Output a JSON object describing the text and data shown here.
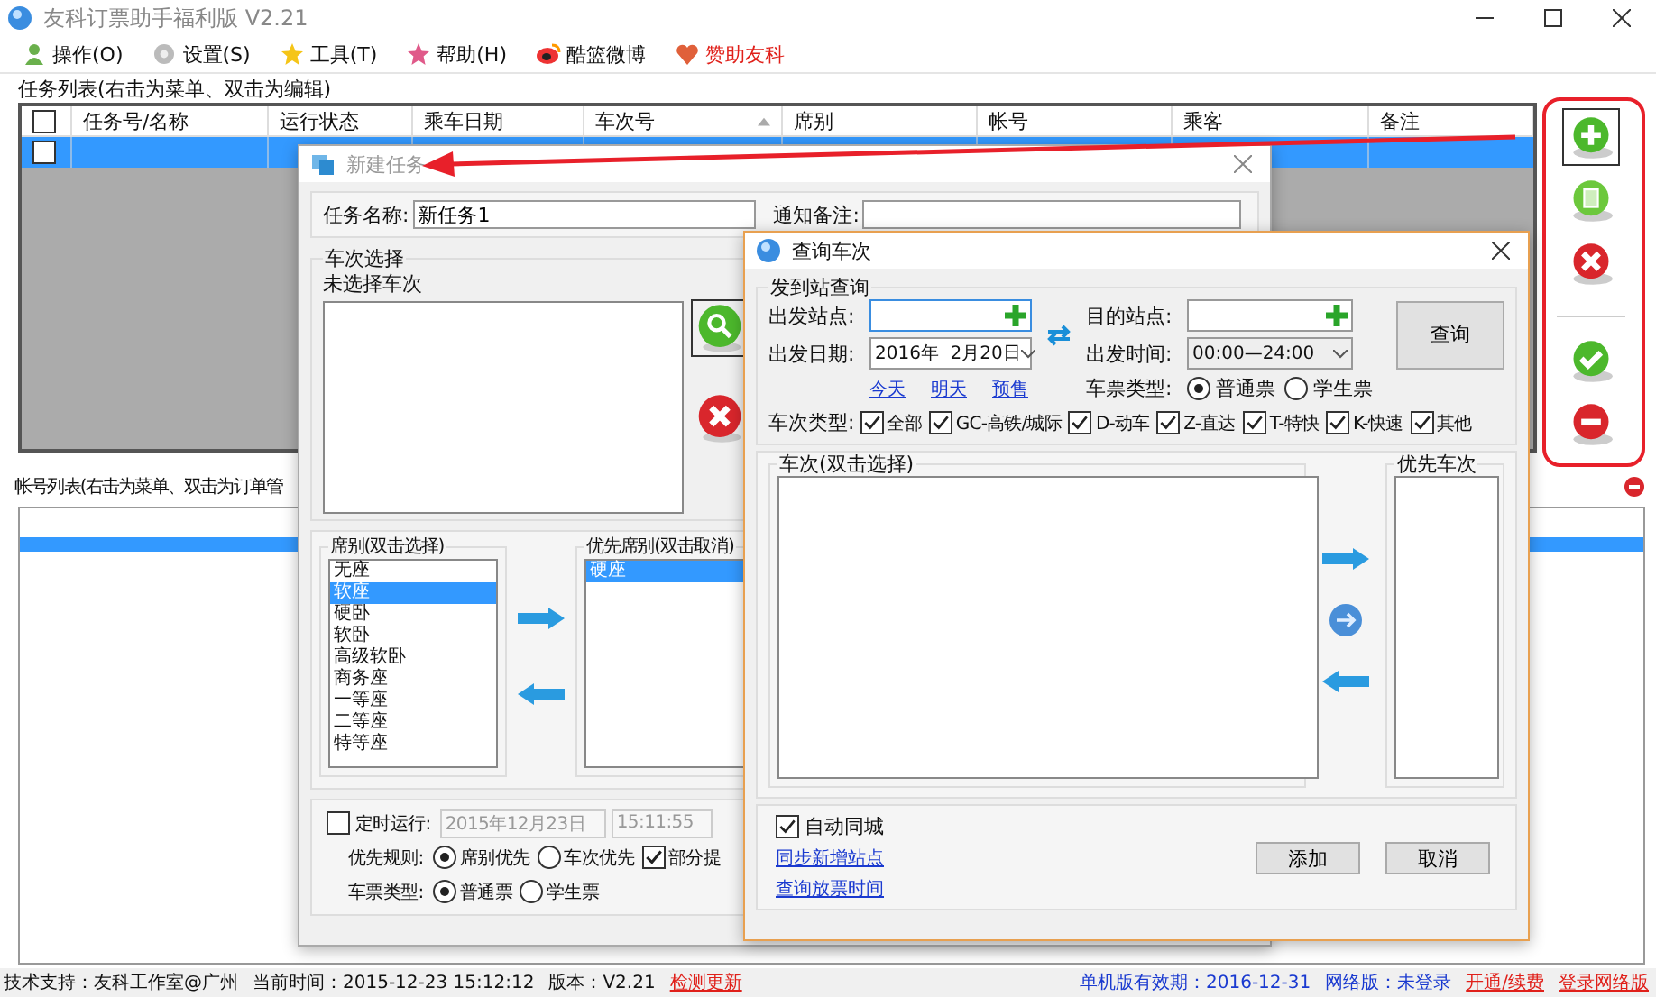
{
  "window": {
    "title": "友科订票助手福利版 V2.21"
  },
  "menu": [
    {
      "label": "操作(O)",
      "kind": "user",
      "emphasized": false
    },
    {
      "label": "设置(S)",
      "kind": "gear",
      "emphasized": false
    },
    {
      "label": "工具(T)",
      "kind": "star",
      "emphasized": false
    },
    {
      "label": "帮助(H)",
      "kind": "help",
      "emphasized": false
    },
    {
      "label": "酷篮微博",
      "kind": "weibo",
      "emphasized": false
    },
    {
      "label": "赞助友科",
      "kind": "heart",
      "emphasized": true
    }
  ],
  "task_list": {
    "title": "任务列表(右击为菜单、双击为编辑)",
    "all_checked": false,
    "columns": [
      {
        "label": "任务号/名称",
        "sorted": false
      },
      {
        "label": "运行状态",
        "sorted": false
      },
      {
        "label": "乘车日期",
        "sorted": false
      },
      {
        "label": "车次号",
        "sorted": true
      },
      {
        "label": "席别",
        "sorted": false
      },
      {
        "label": "帐号",
        "sorted": false
      },
      {
        "label": "乘客",
        "sorted": false
      },
      {
        "label": "备注",
        "sorted": false
      }
    ],
    "rows": [
      {
        "checked": false,
        "selected": true
      }
    ]
  },
  "toolbar": [
    {
      "kind": "add",
      "focused": true
    },
    {
      "kind": "copy",
      "focused": false
    },
    {
      "kind": "delete",
      "focused": false
    },
    {
      "kind": "confirm",
      "focused": false
    },
    {
      "kind": "remove",
      "focused": false
    }
  ],
  "account_list": {
    "title": "帐号列表(右击为菜单、双击为订单管",
    "rows": [
      {
        "selected": true
      }
    ]
  },
  "new_task": {
    "title": "新建任务",
    "name_label": "任务名称:",
    "name_value": "新任务1",
    "note_label": "通知备注:",
    "train_group": "车次选择",
    "train_status": "未选择车次",
    "seat_group": "席别(双击选择)",
    "seats": [
      {
        "label": "无座",
        "selected": false
      },
      {
        "label": "软座",
        "selected": true
      },
      {
        "label": "硬卧",
        "selected": false
      },
      {
        "label": "软卧",
        "selected": false
      },
      {
        "label": "高级软卧",
        "selected": false
      },
      {
        "label": "商务座",
        "selected": false
      },
      {
        "label": "一等座",
        "selected": false
      },
      {
        "label": "二等座",
        "selected": false
      },
      {
        "label": "特等座",
        "selected": false
      }
    ],
    "priority_group": "优先席别(双击取消)",
    "priority_seats": [
      {
        "label": "硬座",
        "selected": true
      }
    ],
    "schedule": {
      "label": "定时运行:",
      "checked": false,
      "date": "2015年12月23日",
      "time": "15:11:55"
    },
    "rule": {
      "label": "优先规则:",
      "options": [
        {
          "label": "席别优先",
          "selected": true
        },
        {
          "label": "车次优先",
          "selected": false
        }
      ],
      "partial": {
        "label": "部分提",
        "checked": true
      }
    },
    "ticket": {
      "label": "车票类型:",
      "options": [
        {
          "label": "普通票",
          "selected": true
        },
        {
          "label": "学生票",
          "selected": false
        }
      ]
    }
  },
  "query": {
    "title": "查询车次",
    "group": "发到站查询",
    "from_label": "出发站点:",
    "to_label": "目的站点:",
    "date_label": "出发日期:",
    "date_value": "2016年  2月20日",
    "time_label": "出发时间:",
    "time_value": "00:00—24:00",
    "quick_dates": [
      "今天",
      "明天",
      "预售"
    ],
    "search_button": "查询",
    "ticket": {
      "label": "车票类型:",
      "options": [
        {
          "label": "普通票",
          "selected": true
        },
        {
          "label": "学生票",
          "selected": false
        }
      ]
    },
    "types_label": "车次类型:",
    "types": [
      {
        "label": "全部",
        "checked": true
      },
      {
        "label": "GC-高铁/城际",
        "checked": true
      },
      {
        "label": "D-动车",
        "checked": true
      },
      {
        "label": "Z-直达",
        "checked": true
      },
      {
        "label": "T-特快",
        "checked": true
      },
      {
        "label": "K-快速",
        "checked": true
      },
      {
        "label": "其他",
        "checked": true
      }
    ],
    "trains_group": "车次(双击选择)",
    "priority_group": "优先车次",
    "auto_city": {
      "label": "自动同城",
      "checked": true
    },
    "links": [
      "同步新增站点",
      "查询放票时间"
    ],
    "buttons": [
      "添加",
      "取消"
    ]
  },
  "status_bar": {
    "left": [
      {
        "text": "技术支持：友科工作室@广州",
        "kind": "text"
      },
      {
        "text": "当前时间：2015-12-23 15:12:12",
        "kind": "text"
      },
      {
        "text": "版本：V2.21",
        "kind": "text"
      },
      {
        "text": "检测更新",
        "kind": "link"
      }
    ],
    "right": [
      {
        "text": "单机版有效期：2016-12-31",
        "kind": "info"
      },
      {
        "text": "网络版：未登录",
        "kind": "info"
      },
      {
        "text": "开通/续费",
        "kind": "link"
      },
      {
        "text": "登录网络版",
        "kind": "link"
      }
    ]
  }
}
